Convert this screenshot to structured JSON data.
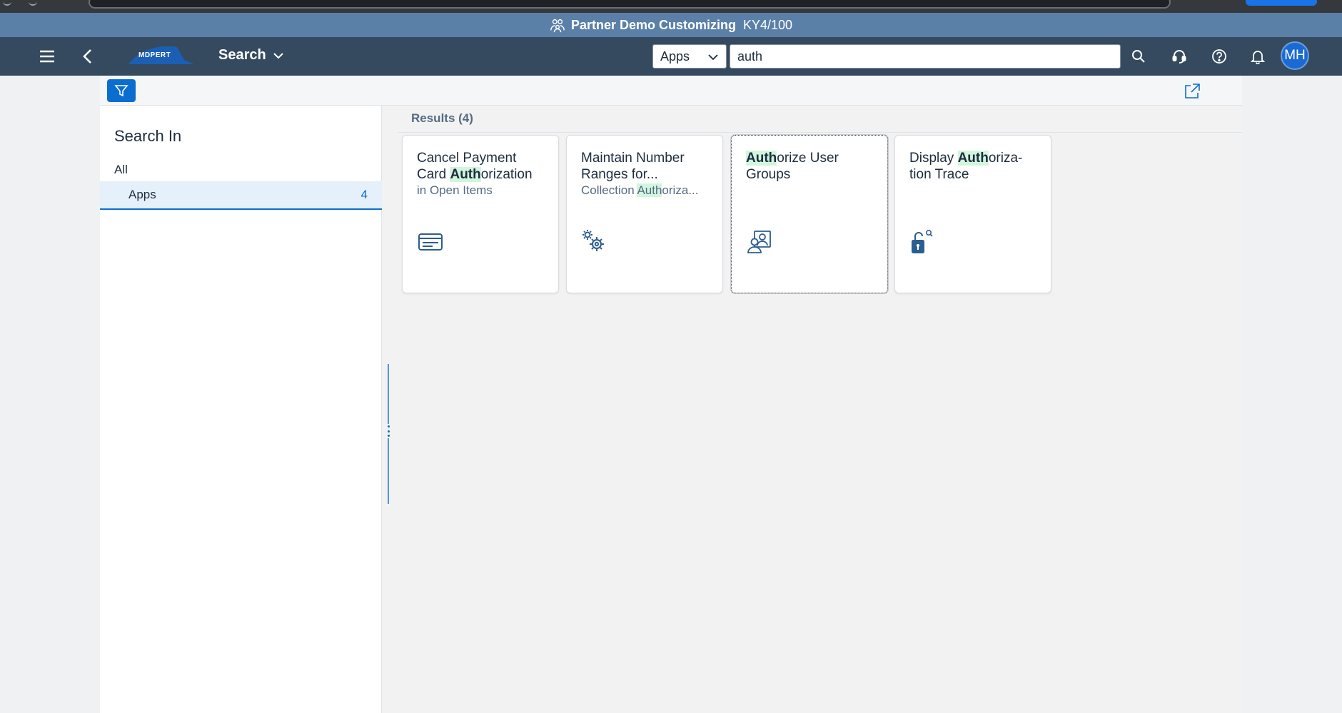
{
  "system_bar": {
    "name": "Partner Demo Customizing",
    "client": "KY4/100"
  },
  "shell": {
    "logo_text": "MDPERT",
    "title": "Search",
    "scope_value": "Apps",
    "search_value": "auth",
    "avatar_initials": "MH"
  },
  "facets": {
    "heading": "Search In",
    "all_label": "All",
    "apps_label": "Apps",
    "apps_count": "4"
  },
  "results": {
    "label": "Results (4)",
    "tiles": [
      {
        "title_pre": "Cancel Payment Card ",
        "title_hl": "Auth",
        "title_post": "orization",
        "sub_pre": "in Open Items",
        "sub_hl": "",
        "sub_post": "",
        "icon": "credit-card-icon"
      },
      {
        "title_pre": "Maintain Number Ranges for...",
        "title_hl": "",
        "title_post": "",
        "sub_pre": "Collection ",
        "sub_hl": "Auth",
        "sub_post": "oriza...",
        "icon": "settings-gears-icon"
      },
      {
        "title_pre": "",
        "title_hl": "Auth",
        "title_post": "orize User Groups",
        "sub_pre": "",
        "sub_hl": "",
        "sub_post": "",
        "icon": "user-group-icon"
      },
      {
        "title_pre": "Display ",
        "title_hl": "Auth",
        "title_post": "oriza-tion Trace",
        "sub_pre": "",
        "sub_hl": "",
        "sub_post": "",
        "icon": "unlock-search-icon"
      }
    ]
  },
  "colors": {
    "shell_bg": "#354a5f",
    "system_bar_bg": "#5b80a8",
    "accent": "#0a6ed1",
    "highlight": "#d2f5de"
  }
}
